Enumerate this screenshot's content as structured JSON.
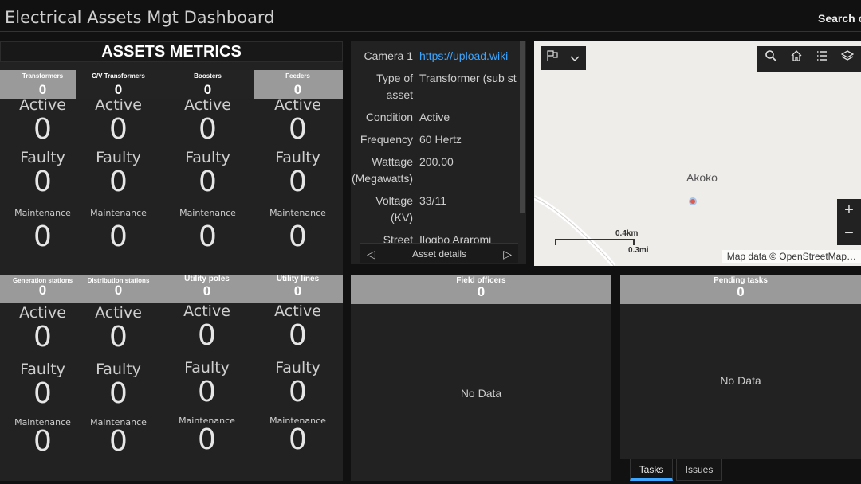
{
  "header": {
    "title": "Electrical Assets Mgt Dashboard",
    "search_label": "Search c"
  },
  "metrics": {
    "title": "ASSETS METRICS",
    "group1": [
      {
        "category": "Transformers",
        "count": "0",
        "active_label": "Active",
        "active": "0",
        "faulty_label": "Faulty",
        "faulty": "0",
        "maint_label": "Maintenance",
        "maint": "0"
      },
      {
        "category": "C/V Transformers",
        "count": "0",
        "active_label": "Active",
        "active": "0",
        "faulty_label": "Faulty",
        "faulty": "0",
        "maint_label": "Maintenance",
        "maint": "0"
      },
      {
        "category": "Boosters",
        "count": "0",
        "active_label": "Active",
        "active": "0",
        "faulty_label": "Faulty",
        "faulty": "0",
        "maint_label": "Maintenance",
        "maint": "0"
      },
      {
        "category": "Feeders",
        "count": "0",
        "active_label": "Active",
        "active": "0",
        "faulty_label": "Faulty",
        "faulty": "0",
        "maint_label": "Maintenance",
        "maint": "0"
      }
    ],
    "group2": [
      {
        "category": "Generation stations",
        "count": "0",
        "active_label": "Active",
        "active": "0",
        "faulty_label": "Faulty",
        "faulty": "0",
        "maint_label": "Maintenance",
        "maint": "0"
      },
      {
        "category": "Distribution stations",
        "count": "0",
        "active_label": "Active",
        "active": "0",
        "faulty_label": "Faulty",
        "faulty": "0",
        "maint_label": "Maintenance",
        "maint": "0"
      },
      {
        "category": "Utility poles",
        "count": "0",
        "active_label": "Active",
        "active": "0",
        "faulty_label": "Faulty",
        "faulty": "0",
        "maint_label": "Maintenance",
        "maint": "0"
      },
      {
        "category": "Utility lines",
        "count": "0",
        "active_label": "Active",
        "active": "0",
        "faulty_label": "Faulty",
        "faulty": "0",
        "maint_label": "Maintenance",
        "maint": "0"
      }
    ]
  },
  "details": {
    "rows": [
      {
        "key": "Camera 1",
        "value": "https://upload.wiki"
      },
      {
        "key": "Type of asset",
        "value": "Transformer (sub st"
      },
      {
        "key": "Condition",
        "value": "Active"
      },
      {
        "key": "Frequency",
        "value": "60 Hertz"
      },
      {
        "key": "Wattage (Megawatts)",
        "value": "200.00"
      },
      {
        "key": "Voltage (KV)",
        "value": "33/11"
      },
      {
        "key": "Street",
        "value": "Ilogbo Araromi"
      }
    ],
    "footer_label": "Asset details"
  },
  "map": {
    "place": "Akoko",
    "scale_km": "0.4km",
    "scale_mi": "0.3mi",
    "attribution": "Map data © OpenStreetMap…",
    "zoom_in": "+",
    "zoom_out": "−"
  },
  "field_officers": {
    "title": "Field officers",
    "count": "0",
    "empty": "No Data"
  },
  "pending_tasks": {
    "title": "Pending tasks",
    "count": "0",
    "empty": "No Data"
  },
  "tabs": [
    {
      "label": "Tasks"
    },
    {
      "label": "Issues"
    }
  ],
  "icons": {
    "map_left": [
      "bookmark-icon",
      "chevron-down-icon"
    ],
    "map_right": [
      "search-icon",
      "home-icon",
      "legend-icon",
      "layers-icon"
    ]
  },
  "colors": {
    "accent": "#3ea6ff",
    "header_bar": "#9a9a9a",
    "panel": "#222222",
    "background": "#111111"
  }
}
